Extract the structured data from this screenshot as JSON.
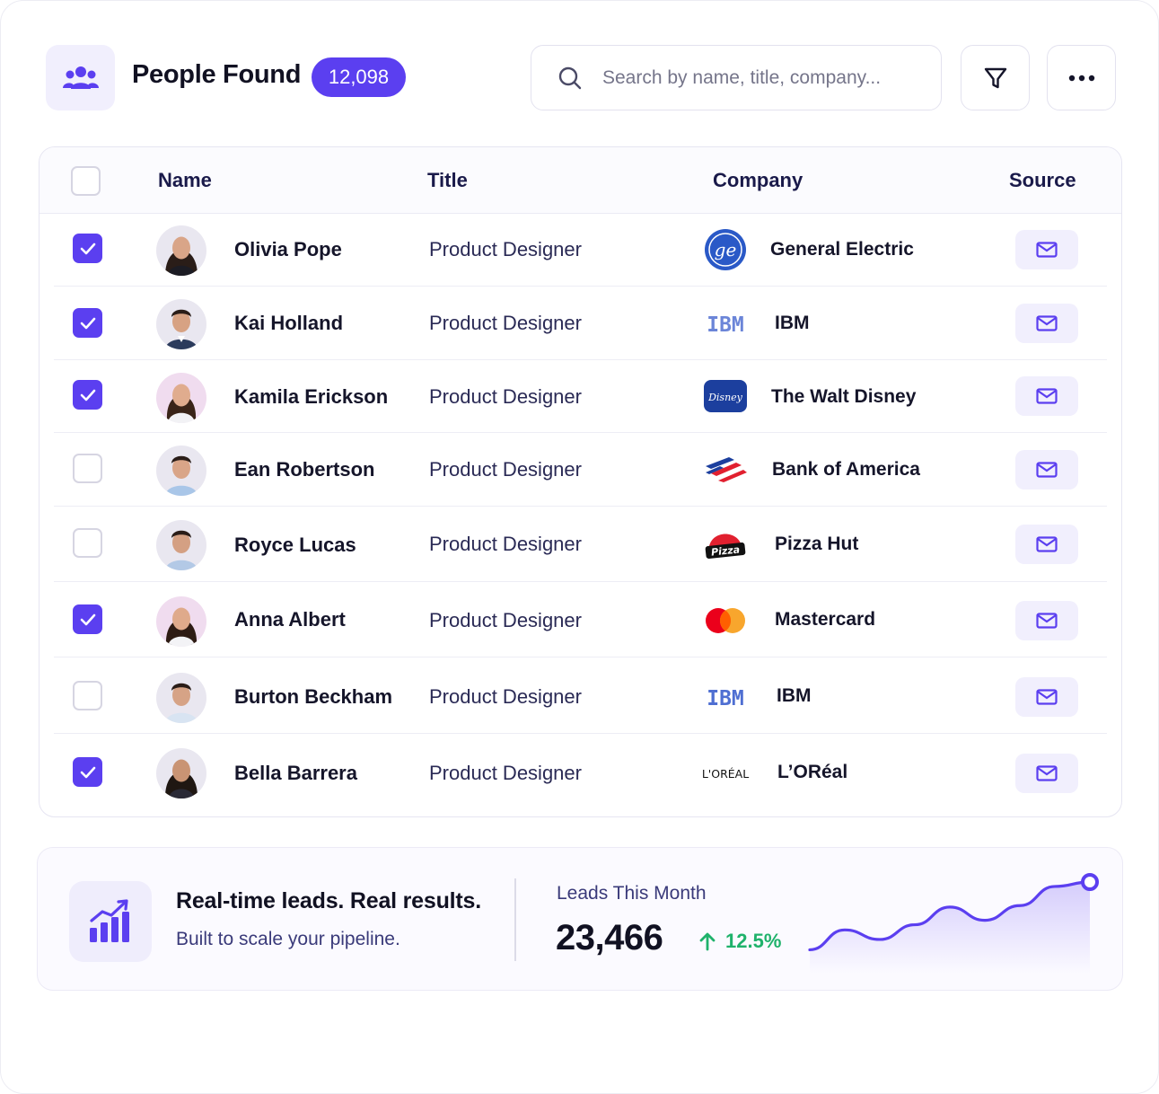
{
  "header": {
    "title": "People Found",
    "count": "12,098",
    "search_placeholder": "Search by name, title, company...",
    "icons": {
      "section": "people-group-icon",
      "search": "search-icon",
      "filter": "filter-icon",
      "more": "more-dots-icon"
    }
  },
  "table": {
    "columns": [
      "Name",
      "Title",
      "Company",
      "Source"
    ],
    "rows": [
      {
        "checked": true,
        "name": "Olivia Pope",
        "title": "Product Designer",
        "company": "General Electric",
        "logo": "ge-logo",
        "source": "mail-icon"
      },
      {
        "checked": true,
        "name": "Kai Holland",
        "title": "Product Designer",
        "company": "IBM",
        "logo": "ibm-logo",
        "source": "mail-icon"
      },
      {
        "checked": true,
        "name": "Kamila Erickson",
        "title": "Product Designer",
        "company": "The Walt Disney",
        "logo": "disney-logo",
        "source": "mail-icon"
      },
      {
        "checked": false,
        "name": "Ean Robertson",
        "title": "Product Designer",
        "company": "Bank of America",
        "logo": "bank-of-america-logo",
        "source": "mail-icon"
      },
      {
        "checked": false,
        "name": "Royce Lucas",
        "title": "Product Designer",
        "company": "Pizza Hut",
        "logo": "pizza-hut-logo",
        "source": "mail-icon"
      },
      {
        "checked": true,
        "name": "Anna Albert",
        "title": "Product Designer",
        "company": "Mastercard",
        "logo": "mastercard-logo",
        "source": "mail-icon"
      },
      {
        "checked": false,
        "name": "Burton Beckham",
        "title": "Product Designer",
        "company": "IBM",
        "logo": "ibm-logo",
        "source": "mail-icon"
      },
      {
        "checked": true,
        "name": "Bella Barrera",
        "title": "Product Designer",
        "company": "L’ORéal",
        "logo": "loreal-logo",
        "source": "mail-icon"
      }
    ],
    "logo_texts": {
      "ibm": "IBM",
      "disney": "Disney",
      "pizza": "Pizza",
      "loreal": "L'ORÉAL"
    }
  },
  "footer": {
    "headline": "Real-time leads. Real results.",
    "subline": "Built to scale your pipeline.",
    "metric_label": "Leads This Month",
    "metric_value": "23,466",
    "delta": "12.5%",
    "delta_direction": "up",
    "sparkline": [
      0.08,
      0.35,
      0.22,
      0.42,
      0.66,
      0.48,
      0.68,
      0.94,
      1.0
    ]
  },
  "colors": {
    "accent": "#5b3ff0",
    "positive": "#1fb26b",
    "accent_soft": "#f1effd"
  }
}
